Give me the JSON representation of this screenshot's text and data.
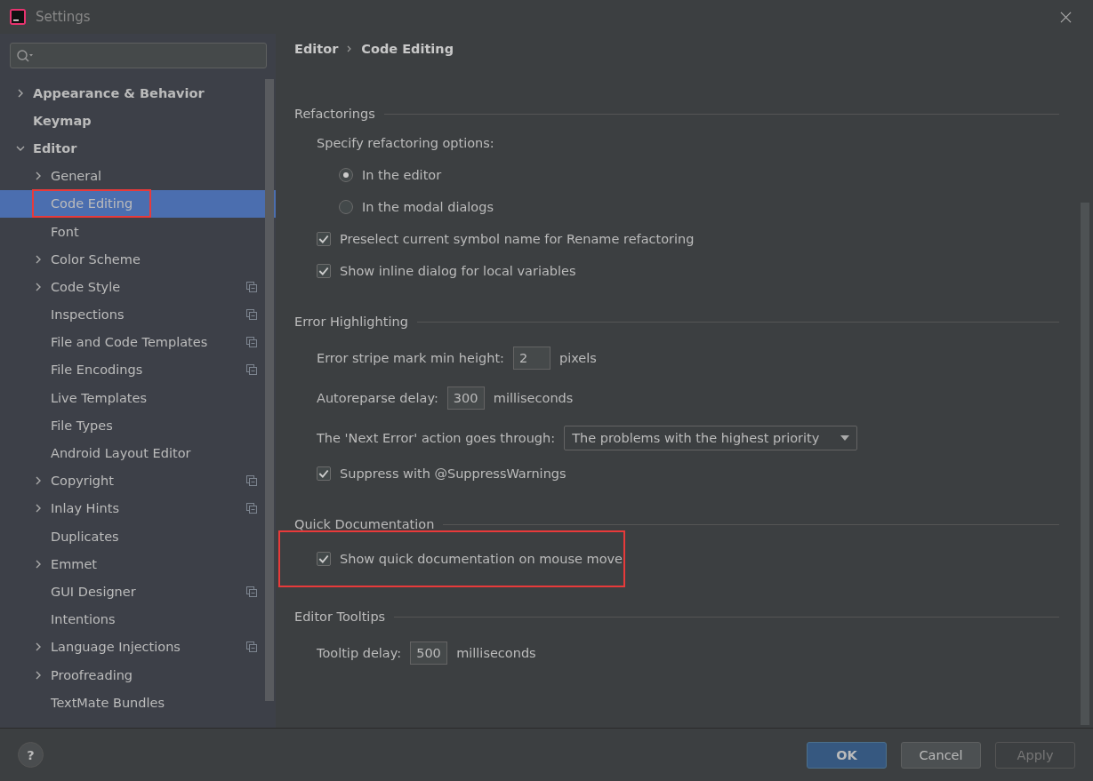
{
  "window": {
    "title": "Settings"
  },
  "sidebar": {
    "items": [
      {
        "label": "Appearance & Behavior",
        "expanded": false,
        "selected": false,
        "project": false,
        "highlighted": false
      },
      {
        "label": "Keymap",
        "selected": false,
        "project": false,
        "highlighted": false
      },
      {
        "label": "Editor",
        "expanded": true,
        "selected": false,
        "project": false,
        "highlighted": false,
        "children": [
          {
            "label": "General",
            "expanded": false,
            "selected": false,
            "project": false,
            "highlighted": false
          },
          {
            "label": "Code Editing",
            "selected": true,
            "project": false,
            "highlighted": true
          },
          {
            "label": "Font",
            "selected": false,
            "project": false,
            "highlighted": false
          },
          {
            "label": "Color Scheme",
            "expanded": false,
            "selected": false,
            "project": false,
            "highlighted": false
          },
          {
            "label": "Code Style",
            "expanded": false,
            "selected": false,
            "project": true,
            "highlighted": false
          },
          {
            "label": "Inspections",
            "selected": false,
            "project": true,
            "highlighted": false
          },
          {
            "label": "File and Code Templates",
            "selected": false,
            "project": true,
            "highlighted": false
          },
          {
            "label": "File Encodings",
            "selected": false,
            "project": true,
            "highlighted": false
          },
          {
            "label": "Live Templates",
            "selected": false,
            "project": false,
            "highlighted": false
          },
          {
            "label": "File Types",
            "selected": false,
            "project": false,
            "highlighted": false
          },
          {
            "label": "Android Layout Editor",
            "selected": false,
            "project": false,
            "highlighted": false
          },
          {
            "label": "Copyright",
            "expanded": false,
            "selected": false,
            "project": true,
            "highlighted": false
          },
          {
            "label": "Inlay Hints",
            "expanded": false,
            "selected": false,
            "project": true,
            "highlighted": false
          },
          {
            "label": "Duplicates",
            "selected": false,
            "project": false,
            "highlighted": false
          },
          {
            "label": "Emmet",
            "expanded": false,
            "selected": false,
            "project": false,
            "highlighted": false
          },
          {
            "label": "GUI Designer",
            "selected": false,
            "project": true,
            "highlighted": false
          },
          {
            "label": "Intentions",
            "selected": false,
            "project": false,
            "highlighted": false
          },
          {
            "label": "Language Injections",
            "expanded": false,
            "selected": false,
            "project": true,
            "highlighted": false
          },
          {
            "label": "Proofreading",
            "expanded": false,
            "selected": false,
            "project": false,
            "highlighted": false
          },
          {
            "label": "TextMate Bundles",
            "selected": false,
            "project": false,
            "highlighted": false
          }
        ]
      }
    ]
  },
  "breadcrumb": [
    "Editor",
    "Code Editing"
  ],
  "sections": [
    {
      "title": "Refactorings",
      "items": [
        {
          "kind": "label",
          "label": "Specify refactoring options:"
        },
        {
          "kind": "radio",
          "label": "In the editor",
          "selected": true
        },
        {
          "kind": "radio",
          "label": "In the modal dialogs",
          "selected": false
        },
        {
          "kind": "checkbox",
          "label": "Preselect current symbol name for Rename refactoring",
          "checked": true,
          "highlighted": false
        },
        {
          "kind": "checkbox",
          "label": "Show inline dialog for local variables",
          "checked": true,
          "highlighted": false
        }
      ]
    },
    {
      "title": "Error Highlighting",
      "items": [
        {
          "kind": "number",
          "label": "Error stripe mark min height:",
          "value": "2",
          "unit": "pixels"
        },
        {
          "kind": "number",
          "label": "Autoreparse delay:",
          "value": "300",
          "unit": "milliseconds"
        },
        {
          "kind": "select",
          "label": "The 'Next Error' action goes through:",
          "value": "The problems with the highest priority"
        },
        {
          "kind": "checkbox",
          "label": "Suppress with @SuppressWarnings",
          "checked": true,
          "highlighted": false
        }
      ]
    },
    {
      "title": "Quick Documentation",
      "items": [
        {
          "kind": "checkbox",
          "label": "Show quick documentation on mouse move",
          "checked": true,
          "highlighted": true
        }
      ]
    },
    {
      "title": "Editor Tooltips",
      "items": [
        {
          "kind": "number",
          "label": "Tooltip delay:",
          "value": "500",
          "unit": "milliseconds"
        }
      ]
    }
  ],
  "buttons": [
    {
      "label": "OK",
      "kind": "default",
      "disabled": false
    },
    {
      "label": "Cancel",
      "kind": "normal",
      "disabled": false
    },
    {
      "label": "Apply",
      "kind": "normal",
      "disabled": true
    }
  ],
  "help": {
    "label": "?"
  }
}
